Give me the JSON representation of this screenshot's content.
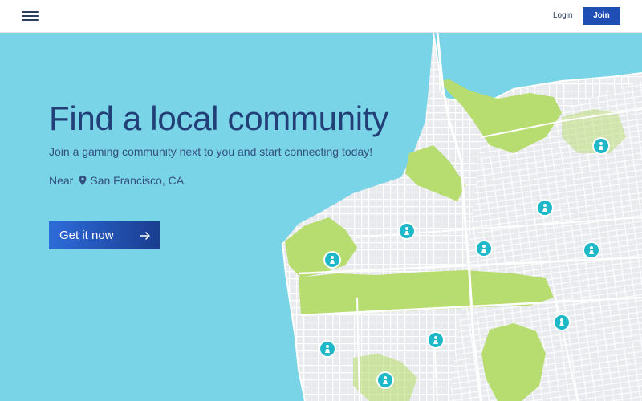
{
  "header": {
    "login_label": "Login",
    "join_label": "Join"
  },
  "hero": {
    "title": "Find a local community",
    "subtitle": "Join a gaming community next to you and start connecting today!",
    "near_label": "Near",
    "location": "San Francisco, CA",
    "cta_label": "Get it now"
  },
  "map": {
    "water_color": "#7ad4e8",
    "land_color": "#e8eaed",
    "park_color": "#b7dc6f",
    "marker_color": "#1fb8c9",
    "marker_icon": "meeple-icon"
  },
  "colors": {
    "primary": "#1f4fb5",
    "title": "#233f78"
  }
}
